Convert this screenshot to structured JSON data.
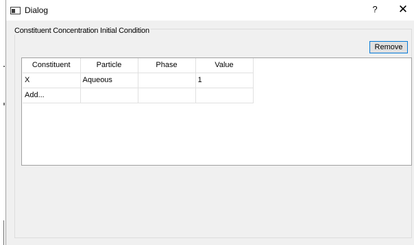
{
  "window": {
    "title": "Dialog",
    "help_label": "?",
    "close_label": "✕"
  },
  "group": {
    "title": "Constituent Concentration Initial Condition"
  },
  "actions": {
    "remove_label": "Remove"
  },
  "table": {
    "headers": [
      "Constituent",
      "Particle",
      "Phase",
      "Value"
    ],
    "rows": [
      [
        "X",
        "Aqueous",
        "",
        "1"
      ],
      [
        "Add...",
        "",
        "",
        ""
      ]
    ]
  }
}
